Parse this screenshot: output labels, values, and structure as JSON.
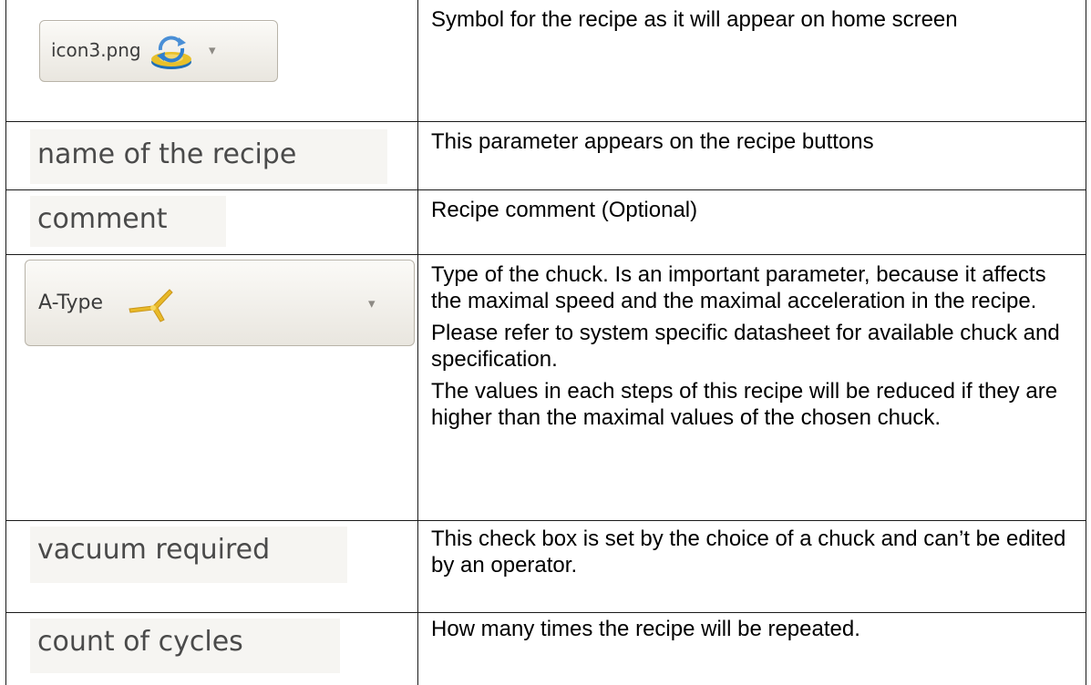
{
  "rows": [
    {
      "widget": {
        "kind": "combo",
        "text": "icon3.png",
        "icon": "refresh-disc-icon",
        "arrow": "▾"
      },
      "description": [
        "Symbol for the recipe as it will appear on home screen"
      ]
    },
    {
      "widget": {
        "kind": "label",
        "text": "name of the recipe"
      },
      "description": [
        "This parameter appears on the recipe buttons"
      ]
    },
    {
      "widget": {
        "kind": "label",
        "text": "comment"
      },
      "description": [
        "Recipe comment (Optional)"
      ]
    },
    {
      "widget": {
        "kind": "combo",
        "text": "A-Type",
        "icon": "chuck-a-type-icon",
        "arrow": "▾"
      },
      "description": [
        "Type of the chuck. Is an important parameter, because it affects the maximal speed and the maximal acceleration in the recipe.",
        "Please refer to system specific datasheet for available chuck and specification.",
        "The values in each steps of this recipe will be reduced if they are higher than the maximal values of the chosen chuck."
      ]
    },
    {
      "widget": {
        "kind": "label",
        "text": "vacuum required"
      },
      "description": [
        "This check box is set by the choice of a chuck and can’t be edited by an operator."
      ]
    },
    {
      "widget": {
        "kind": "label",
        "text": "count of cycles"
      },
      "description": [
        "How many times the recipe will be repeated."
      ]
    }
  ],
  "colors": {
    "border": "#1a1a1a",
    "widget_background": "#f6f5f2",
    "widget_text": "#3c3c3c",
    "chuck_icon": "#e8b928",
    "disc_icon": "#4a8fd6"
  }
}
